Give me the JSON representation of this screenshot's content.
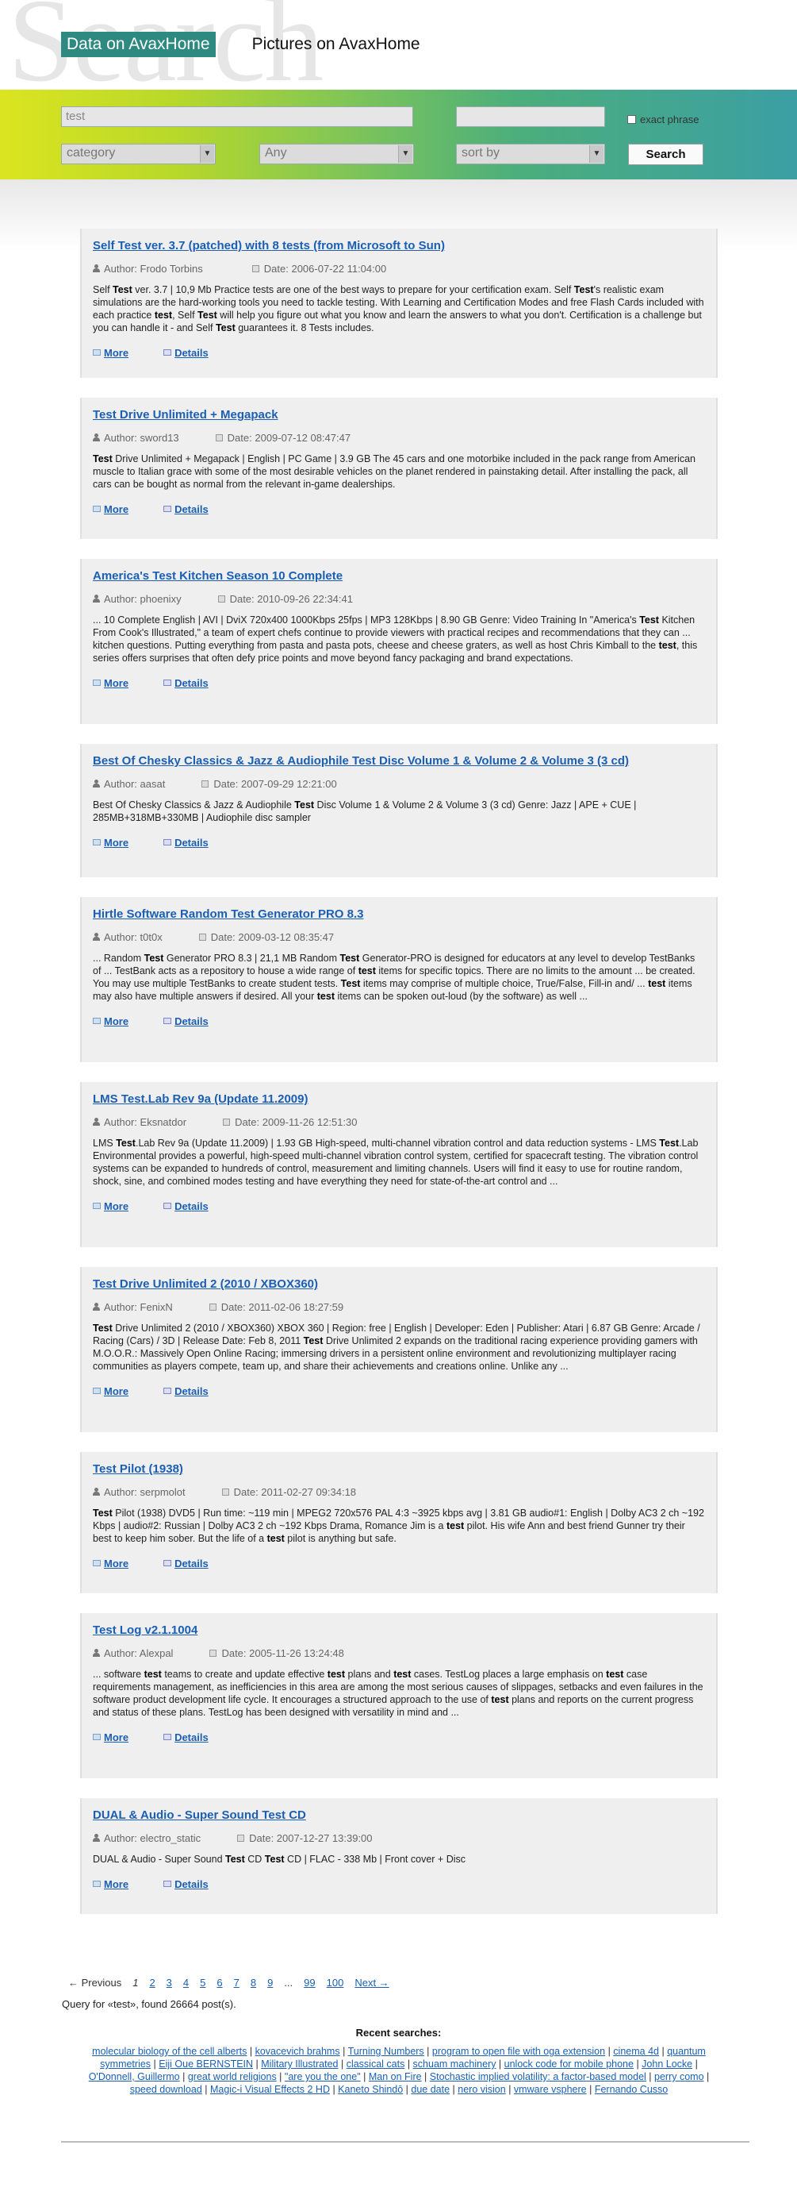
{
  "header": {
    "bg_word": "Search",
    "tab_active": "Data on AvaxHome",
    "tab_other": "Pictures on AvaxHome"
  },
  "search": {
    "query_value": "test",
    "phrase_value": "",
    "exact_phrase_label": "exact phrase",
    "category": "category",
    "any": "Any",
    "sort_by": "sort by",
    "search_button": "Search"
  },
  "results": [
    {
      "title": "Self Test ver. 3.7 (patched) with 8 tests (from Microsoft to Sun)",
      "author": "Author: Frodo Torbins",
      "date": "Date: 2006-07-22 11:04:00",
      "desc": "Self <b>Test</b> ver. 3.7 | 10,9 Mb Practice tests are one of the best ways to prepare for your certification exam. Self <b>Test</b>'s realistic exam simulations are the hard-working tools you need to tackle testing. With Learning and Certification Modes and free Flash Cards included with each practice <b>test</b>, Self <b>Test</b> will help you figure out what you know and learn the answers to what you don't. Certification is a challenge but you can handle it - and Self <b>Test</b> guarantees it. 8 Tests includes."
    },
    {
      "title": "Test Drive Unlimited + Megapack",
      "author": "Author: sword13",
      "date": "Date: 2009-07-12 08:47:47",
      "desc": "<b>Test</b> Drive Unlimited + Megapack | English | PC Game | 3.9 GB The 45 cars and one motorbike included in the pack range from American muscle to Italian grace with some of the most desirable vehicles on the planet rendered in painstaking detail. After installing the pack, all cars can be bought as normal from the relevant in-game dealerships."
    },
    {
      "title": "America's Test Kitchen Season 10 Complete",
      "author": "Author: phoenixy",
      "date": "Date: 2010-09-26 22:34:41",
      "desc": "... 10 Complete English | AVI | DviX 720x400 1000Kbps 25fps | MP3 128Kbps | 8.90 GB Genre: Video Training In \"America's <b>Test</b> Kitchen From Cook's Illustrated,\" a team of expert chefs continue to provide viewers with practical recipes and recommendations that they can ... kitchen questions. Putting everything from pasta and pasta pots, cheese and cheese graters, as well as host Chris Kimball to the <b>test</b>, this series offers surprises that often defy price points and move beyond fancy packaging and brand expectations."
    },
    {
      "title": "Best Of Chesky Classics & Jazz & Audiophile Test Disc Volume 1 & Volume 2 & Volume 3 (3 cd)",
      "author": "Author: aasat",
      "date": "Date: 2007-09-29 12:21:00",
      "desc": "Best Of Chesky Classics & Jazz & Audiophile <b>Test</b> Disc Volume 1 & Volume 2 & Volume 3 (3 cd) Genre: Jazz | APE + CUE | 285MB+318MB+330MB | Audiophile disc sampler"
    },
    {
      "title": "Hirtle Software Random Test Generator PRO 8.3",
      "author": "Author: t0t0x",
      "date": "Date: 2009-03-12 08:35:47",
      "desc": "... Random <b>Test</b> Generator PRO 8.3 | 21,1 MB Random <b>Test</b> Generator-PRO is designed for educators at any level to develop TestBanks of ... TestBank acts as a repository to house a wide range of <b>test</b> items for specific topics. There are no limits to the amount ... be created. You may use multiple TestBanks to create student tests. <b>Test</b> items may comprise of multiple choice, True/False, Fill-in and/ ... <b>test</b> items may also have multiple answers if desired. All your <b>test</b> items can be spoken out-loud (by the software) as well ..."
    },
    {
      "title": "LMS Test.Lab Rev 9a (Update 11.2009)",
      "author": "Author: Eksnatdor",
      "date": "Date: 2009-11-26 12:51:30",
      "desc": "LMS <b>Test</b>.Lab Rev 9a (Update 11.2009) | 1.93 GB High-speed, multi-channel vibration control and data reduction systems - LMS <b>Test</b>.Lab Environmental provides a powerful, high-speed multi-channel vibration control system, certified for spacecraft testing. The vibration control systems can be expanded to hundreds of control, measurement and limiting channels. Users will find it easy to use for routine random, shock, sine, and combined modes testing and have everything they need for state-of-the-art control and ..."
    },
    {
      "title": "Test Drive Unlimited 2 (2010 / XBOX360)",
      "author": "Author: FenixN",
      "date": "Date: 2011-02-06 18:27:59",
      "desc": "<b>Test</b> Drive Unlimited 2 (2010 / XBOX360) XBOX 360 | Region: free | English | Developer: Eden | Publisher: Atari | 6.87 GB Genre: Arcade / Racing (Cars) / 3D | Release Date: Feb 8, 2011 <b>Test</b> Drive Unlimited 2 expands on the traditional racing experience providing gamers with M.O.O.R.: Massively Open Online Racing; immersing drivers in a persistent online environment and revolutionizing multiplayer racing communities as players compete, team up, and share their achievements and creations online. Unlike any ..."
    },
    {
      "title": "Test Pilot (1938)",
      "author": "Author: serpmolot",
      "date": "Date: 2011-02-27 09:34:18",
      "desc": "<b>Test</b> Pilot (1938) DVD5 | Run time: ~119 min | MPEG2 720x576 PAL 4:3 ~3925 kbps avg | 3.81 GB audio#1: English | Dolby AC3 2 ch ~192 Kbps | audio#2: Russian | Dolby AC3 2 ch ~192 Kbps Drama, Romance Jim is a <b>test</b> pilot. His wife Ann and best friend Gunner try their best to keep him sober. But the life of a <b>test</b> pilot is anything but safe."
    },
    {
      "title": "Test Log v2.1.1004",
      "author": "Author: Alexpal",
      "date": "Date: 2005-11-26 13:24:48",
      "desc": "... software <b>test</b> teams to create and update effective <b>test</b> plans and <b>test</b> cases. TestLog places a large emphasis on <b>test</b> case requirements management, as inefficiencies in this area are among the most serious causes of slippages, setbacks and even failures in the software product development life cycle. It encourages a structured approach to the use of <b>test</b> plans and reports on the current progress and status of these plans. TestLog has been designed with versatility in mind and ..."
    },
    {
      "title": "DUAL & Audio - Super Sound Test CD",
      "author": "Author: electro_static",
      "date": "Date: 2007-12-27 13:39:00",
      "desc": "DUAL & Audio - Super Sound <b>Test</b> CD <b>Test</b> CD | FLAC - 338 Mb | Front cover + Disc"
    }
  ],
  "actions": {
    "more": "More",
    "details": "Details"
  },
  "pager": {
    "prev": "← Previous",
    "current": "1",
    "pages": [
      "2",
      "3",
      "4",
      "5",
      "6",
      "7",
      "8",
      "9"
    ],
    "ellipsis": "...",
    "p99": "99",
    "p100": "100",
    "next": "Next →"
  },
  "query_info": "Query for «test», found 26664 post(s).",
  "recent": {
    "heading": "Recent searches:",
    "items": [
      "molecular biology of the cell alberts",
      "kovacevich brahms",
      "Turning Numbers",
      "program to open file with oga extension",
      "cinema 4d",
      "quantum symmetries",
      "Eiji Oue BERNSTEIN",
      "Military Illustrated",
      "classical cats",
      "schuam machinery",
      "unlock code for mobile phone",
      "John Locke",
      "O'Donnell, Guillermo",
      "great world religions",
      "\"are you the one\"",
      "Man on Fire",
      "Stochastic implied volatility: a factor-based model",
      "perry como",
      "speed download",
      "Magic-i Visual Effects 2 HD",
      "Kaneto Shindō",
      "due date",
      "nero vision",
      "vmware vsphere",
      "Fernando Cusso"
    ]
  },
  "colors": {
    "accent": "#2e8a80",
    "link": "#1a5fb4",
    "card_bg": "#efefef"
  }
}
